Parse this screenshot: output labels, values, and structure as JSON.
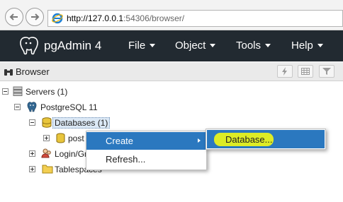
{
  "browser": {
    "url_host": "http://127.0.0.1",
    "url_rest": ":54306/browser/"
  },
  "navbar": {
    "brand": "pgAdmin 4",
    "menus": [
      "File",
      "Object",
      "Tools",
      "Help"
    ]
  },
  "panel": {
    "title": "Browser"
  },
  "tree": {
    "servers": "Servers (1)",
    "postgres_server": "PostgreSQL 11",
    "databases": "Databases (1)",
    "postgres_db": "post",
    "login_roles": "Login/Gr",
    "tablespaces": "Tablespaces"
  },
  "context_menu": {
    "items": [
      "Create",
      "Refresh..."
    ]
  },
  "submenu": {
    "items": [
      "Database..."
    ]
  },
  "colors": {
    "navbar_bg": "#222a31",
    "menu_highlight": "#2b78bf",
    "annotation_highlight": "#e7f21d"
  }
}
